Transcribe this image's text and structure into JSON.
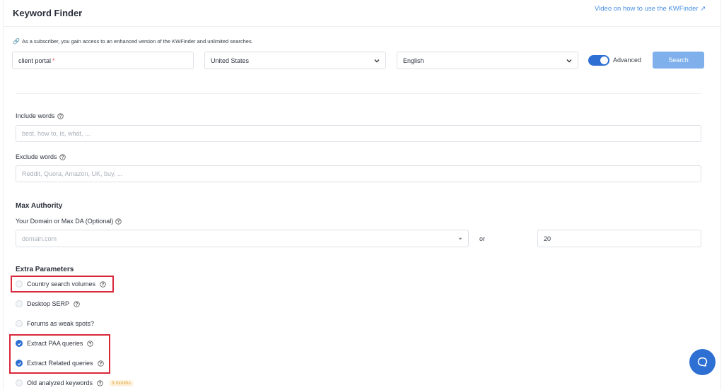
{
  "header": {
    "title": "Keyword Finder",
    "video_link": "Video on how to use the KWFinder ↗"
  },
  "notice": {
    "icon": "link-icon",
    "text": "As a subscriber, you gain access to an enhanced version of the KWFinder and unlimited searches."
  },
  "search_bar": {
    "keyword_value": "client portal",
    "required_mark": "*",
    "country": "United States",
    "language": "English",
    "advanced_label": "Advanced",
    "advanced_on": true,
    "search_label": "Search"
  },
  "include": {
    "label": "Include words",
    "placeholder": "best, how to, is, what, ..."
  },
  "exclude": {
    "label": "Exclude words",
    "placeholder": "Reddit, Quora, Amazon, UK, buy, ..."
  },
  "max_authority": {
    "title": "Max Authority",
    "label": "Your Domain or Max DA (Optional)",
    "domain_placeholder": "domain.com",
    "or_text": "or",
    "da_value": "20"
  },
  "extra": {
    "title": "Extra Parameters",
    "options": [
      {
        "label": "Country search volumes",
        "checked": false
      },
      {
        "label": "Desktop SERP",
        "checked": false
      },
      {
        "label": "Forums as weak spots?",
        "checked": false
      },
      {
        "label": "Extract PAA queries",
        "checked": true
      },
      {
        "label": "Extract Related queries",
        "checked": true
      },
      {
        "label": "Old analyzed keywords",
        "checked": false,
        "badge": "3 months"
      }
    ]
  },
  "colors": {
    "accent": "#2d6fd2",
    "search_button": "#7fb0ec",
    "highlight": "#d9283a",
    "badge_text": "#e2a33c"
  }
}
